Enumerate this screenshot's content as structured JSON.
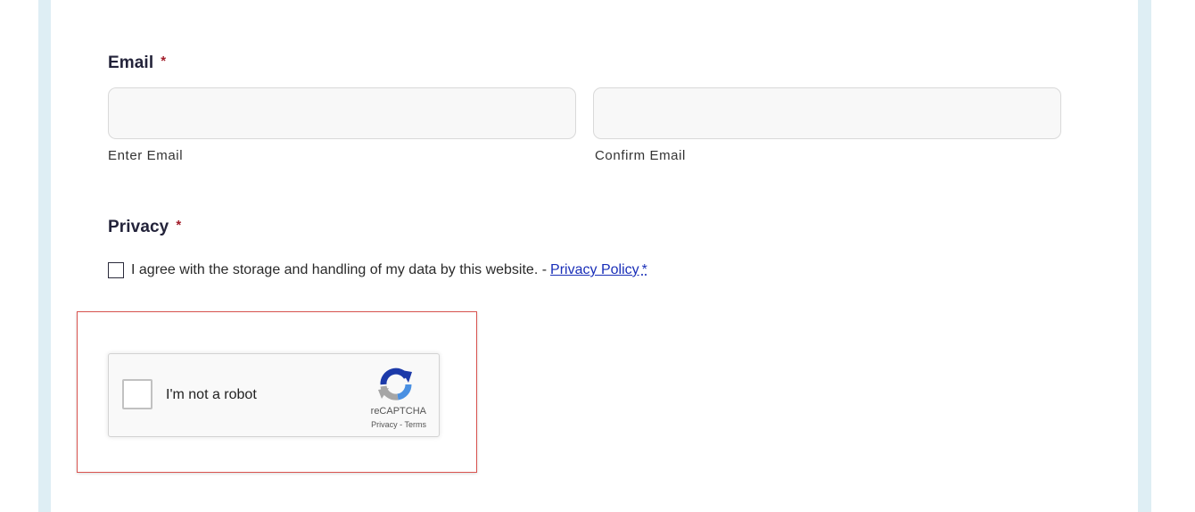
{
  "email": {
    "label": "Email",
    "required_mark": "*",
    "enter": {
      "value": "",
      "placeholder": "",
      "sublabel": "Enter Email"
    },
    "confirm": {
      "value": "",
      "placeholder": "",
      "sublabel": "Confirm Email"
    }
  },
  "privacy": {
    "label": "Privacy",
    "required_mark": "*",
    "consent_text": "I agree with the storage and handling of my data by this website. -",
    "link_text": "Privacy Policy",
    "star": "*"
  },
  "recaptcha": {
    "checkbox_label": "I'm not a robot",
    "brand": "reCAPTCHA",
    "privacy_link": "Privacy",
    "separator": "-",
    "terms_link": "Terms",
    "icon": "recaptcha-logo-icon"
  },
  "colors": {
    "side_bar": "#deeef4",
    "required": "#a21d2a",
    "link": "#1a2fb8",
    "highlight_border": "#d9534f"
  }
}
